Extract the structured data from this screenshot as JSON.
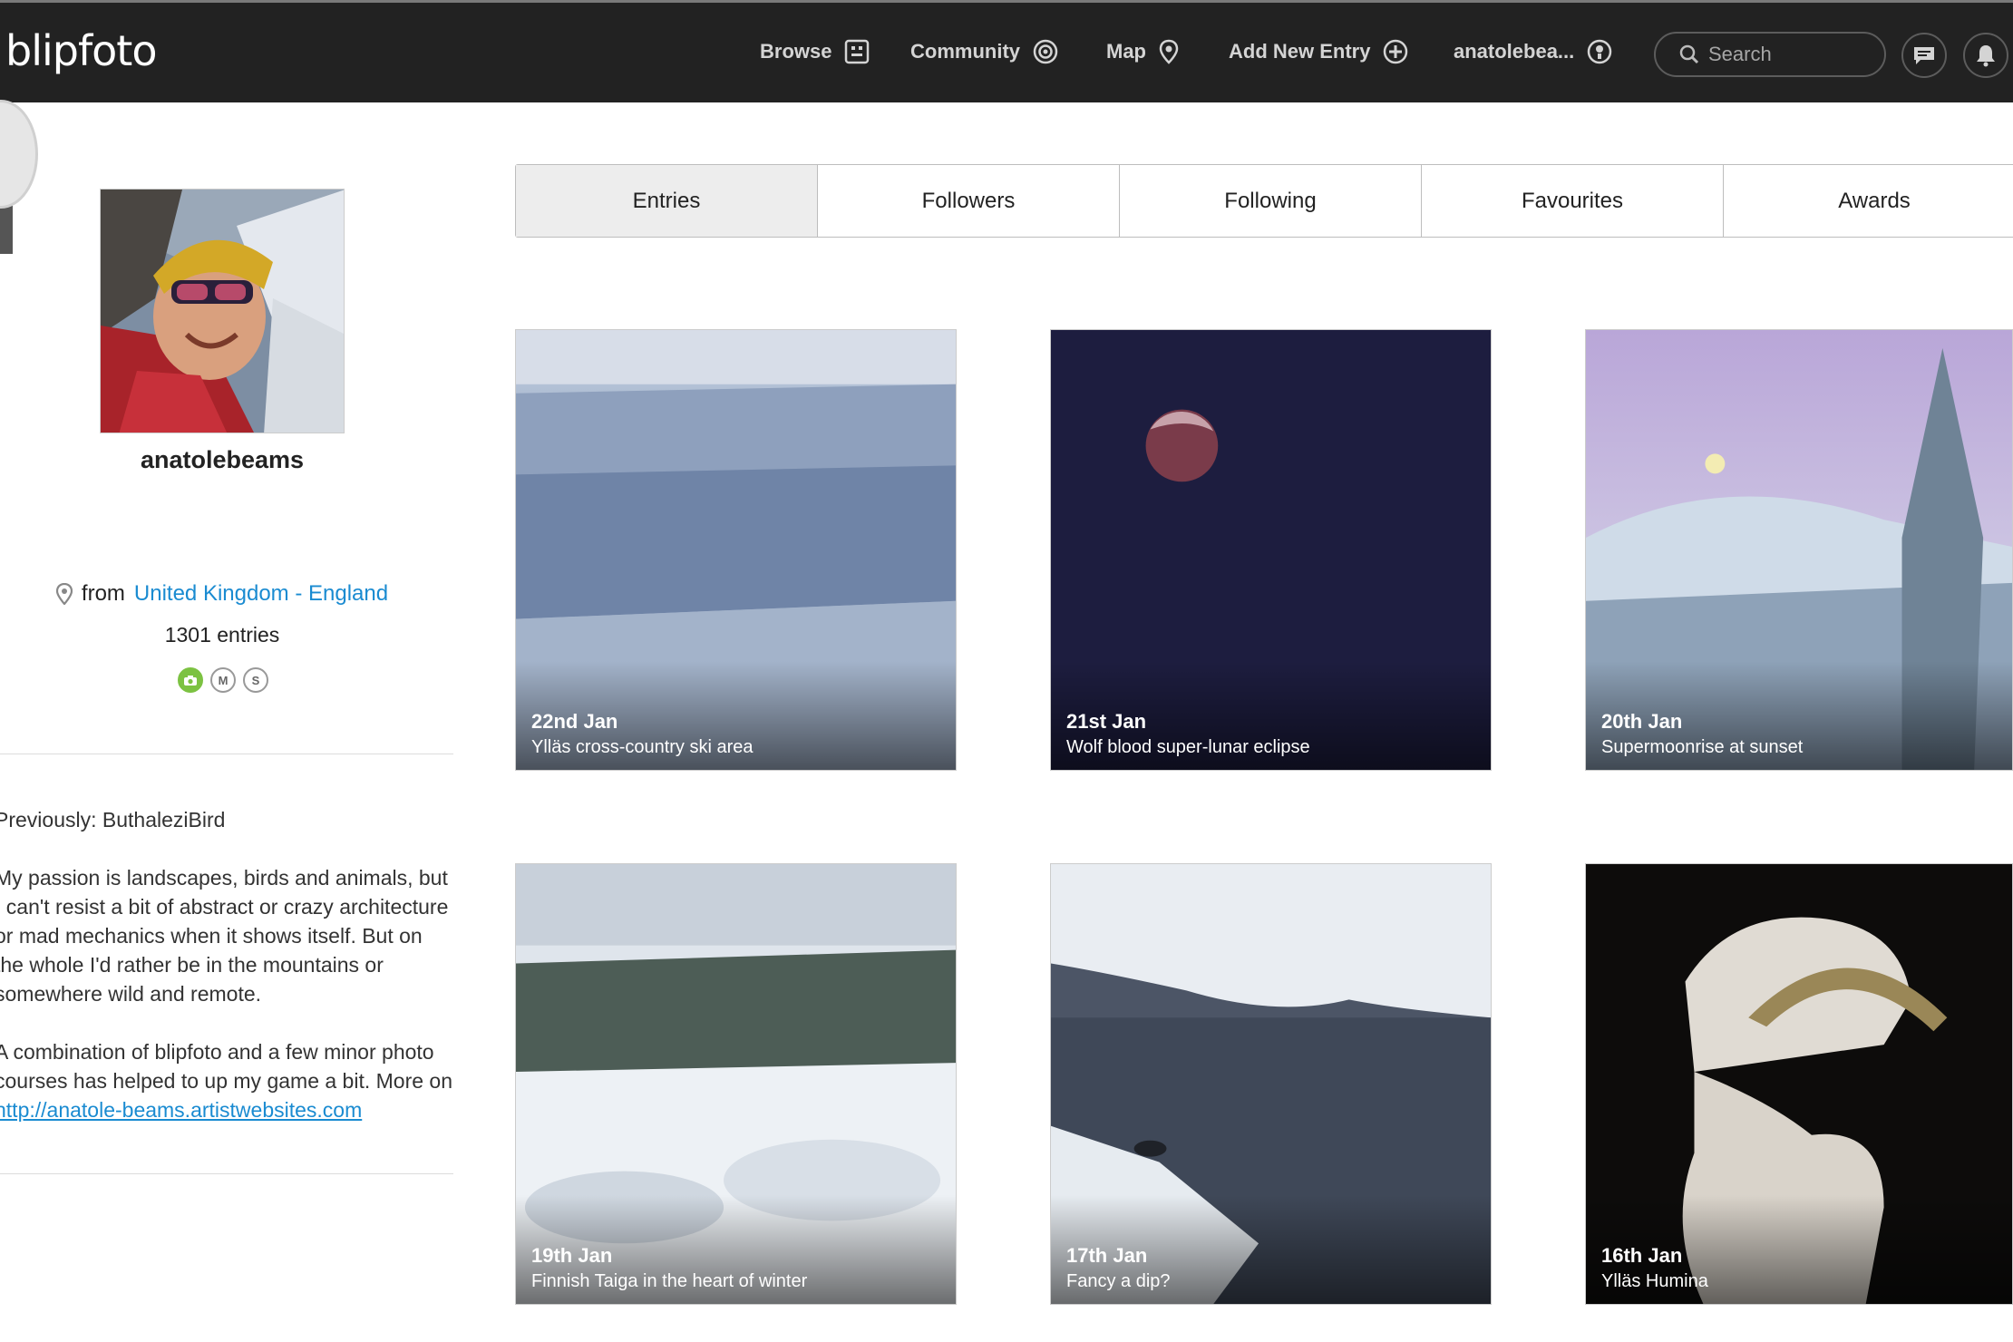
{
  "topbar": {
    "logo": "blipfoto",
    "nav": [
      {
        "label": "Browse",
        "icon": "grid-icon"
      },
      {
        "label": "Community",
        "icon": "broadcast-icon"
      },
      {
        "label": "Map",
        "icon": "map-pin-icon"
      },
      {
        "label": "Add New Entry",
        "icon": "plus-circle-icon"
      },
      {
        "label": "anatolebea...",
        "icon": "user-circle-icon"
      }
    ],
    "search_placeholder": "Search",
    "icons": [
      "search-icon",
      "messages-icon",
      "notifications-icon"
    ]
  },
  "profile": {
    "username": "anatolebeams",
    "from_label": "from",
    "location": "United Kingdom - England",
    "entries": "1301 entries",
    "mini_badges": [
      "camera",
      "M",
      "S"
    ],
    "bio": {
      "previously": "Previously: ButhaleziBird",
      "para1": "My passion is landscapes, birds and animals, but I can't resist a bit of abstract or crazy architecture or mad mechanics when it shows itself. But on the whole I'd rather be in the mountains or somewhere wild and remote.",
      "para2_text": "A combination of blipfoto and a few minor photo courses has helped to up my game a bit. More on",
      "para2_link": "http://anatole-beams.artistwebsites.com"
    }
  },
  "tabs": [
    "Entries",
    "Followers",
    "Following",
    "Favourites",
    "Awards"
  ],
  "active_tab": "Entries",
  "entries": [
    {
      "date": "22nd Jan",
      "caption": "Ylläs cross-country ski area"
    },
    {
      "date": "21st Jan",
      "caption": "Wolf blood super-lunar eclipse"
    },
    {
      "date": "20th Jan",
      "caption": "Supermoonrise at sunset"
    },
    {
      "date": "19th Jan",
      "caption": "Finnish Taiga in the heart of winter"
    },
    {
      "date": "17th Jan",
      "caption": "Fancy a dip?"
    },
    {
      "date": "16th Jan",
      "caption": "Ylläs Humina"
    }
  ],
  "colors": {
    "topbar": "#222222",
    "link": "#1a8bd1",
    "active_tab": "#ededed",
    "green_badge": "#7cc242"
  }
}
